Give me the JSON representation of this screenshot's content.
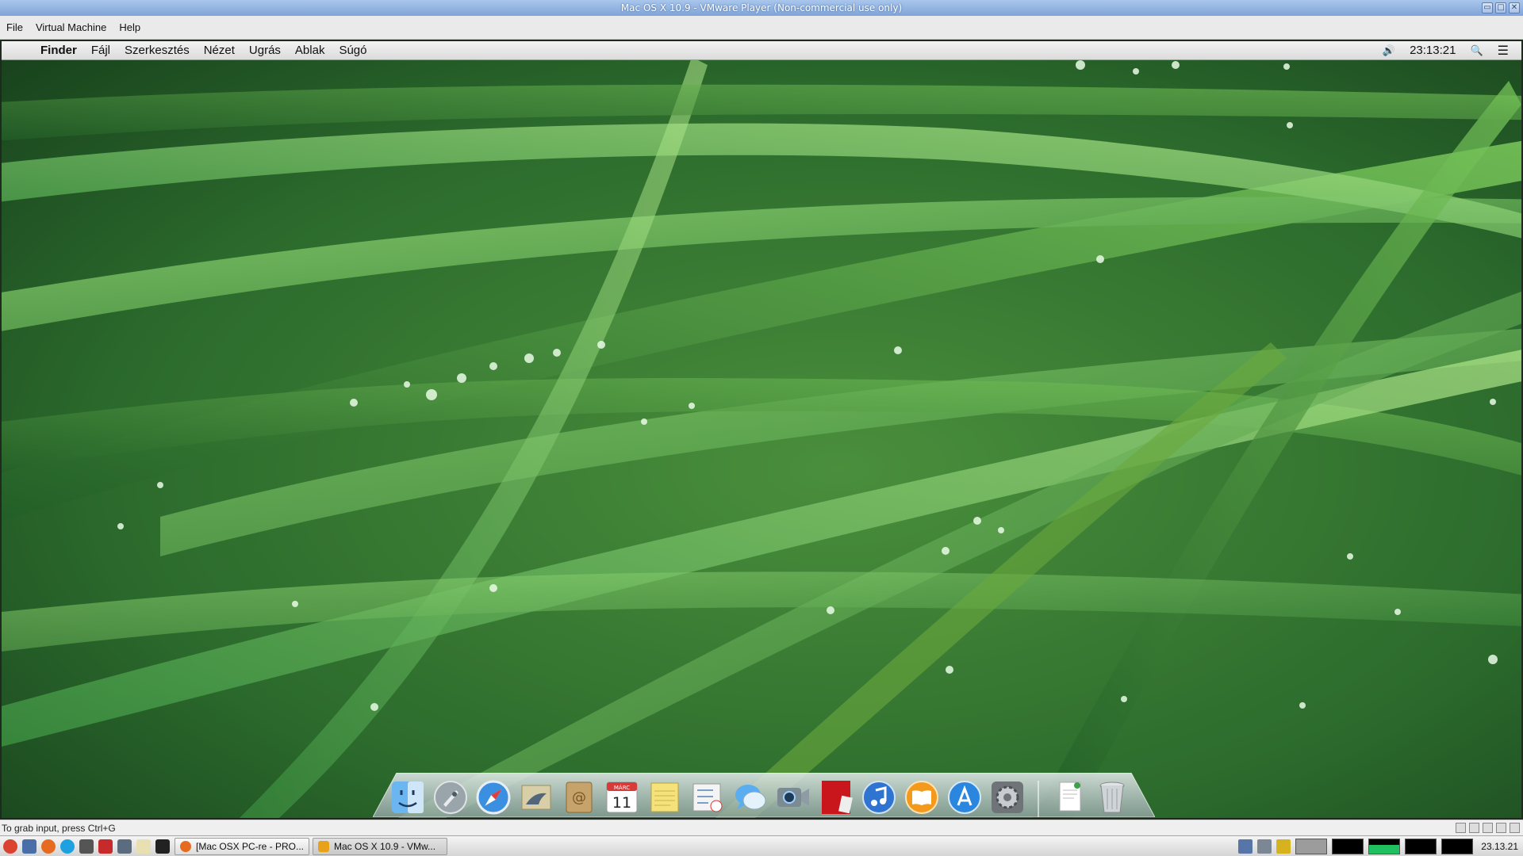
{
  "vm_window": {
    "title": "Mac OS X 10.9 - VMware Player (Non-commercial use only)",
    "minimize_glyph": "▭",
    "maximize_glyph": "□",
    "close_glyph": "✕",
    "menu": [
      "File",
      "Virtual Machine",
      "Help"
    ],
    "status_text": "To grab input, press Ctrl+G"
  },
  "mac_menubar": {
    "apple_glyph": "",
    "app_name": "Finder",
    "menus": [
      "Fájl",
      "Szerkesztés",
      "Nézet",
      "Ugrás",
      "Ablak",
      "Súgó"
    ],
    "volume_glyph": "🔊",
    "clock": "23:13:21",
    "search_glyph": "🔍",
    "list_glyph": "☰"
  },
  "dock": {
    "items": [
      {
        "icon": "finder-icon"
      },
      {
        "icon": "launchpad-icon"
      },
      {
        "icon": "safari-icon"
      },
      {
        "icon": "mail-icon"
      },
      {
        "icon": "contacts-icon"
      },
      {
        "icon": "calendar-icon",
        "month": "MÁRC",
        "day": "11"
      },
      {
        "icon": "notes-icon"
      },
      {
        "icon": "reminders-icon"
      },
      {
        "icon": "messages-icon"
      },
      {
        "icon": "facetime-icon"
      },
      {
        "icon": "photo-booth-icon"
      },
      {
        "icon": "itunes-icon"
      },
      {
        "icon": "ibooks-icon"
      },
      {
        "icon": "app-store-icon"
      },
      {
        "icon": "system-preferences-icon"
      }
    ],
    "after_separator": [
      {
        "icon": "document-stack-icon"
      },
      {
        "icon": "trash-icon"
      }
    ]
  },
  "taskbar": {
    "tasks": [
      {
        "label": "[Mac OSX PC-re - PRO..."
      },
      {
        "label": "Mac OS X 10.9 - VMw..."
      }
    ],
    "clock": "23.13.21"
  },
  "colors": {
    "grass_dark": "#1f4a22",
    "grass_mid": "#3f8a3a",
    "grass_light": "#8fd26e"
  }
}
